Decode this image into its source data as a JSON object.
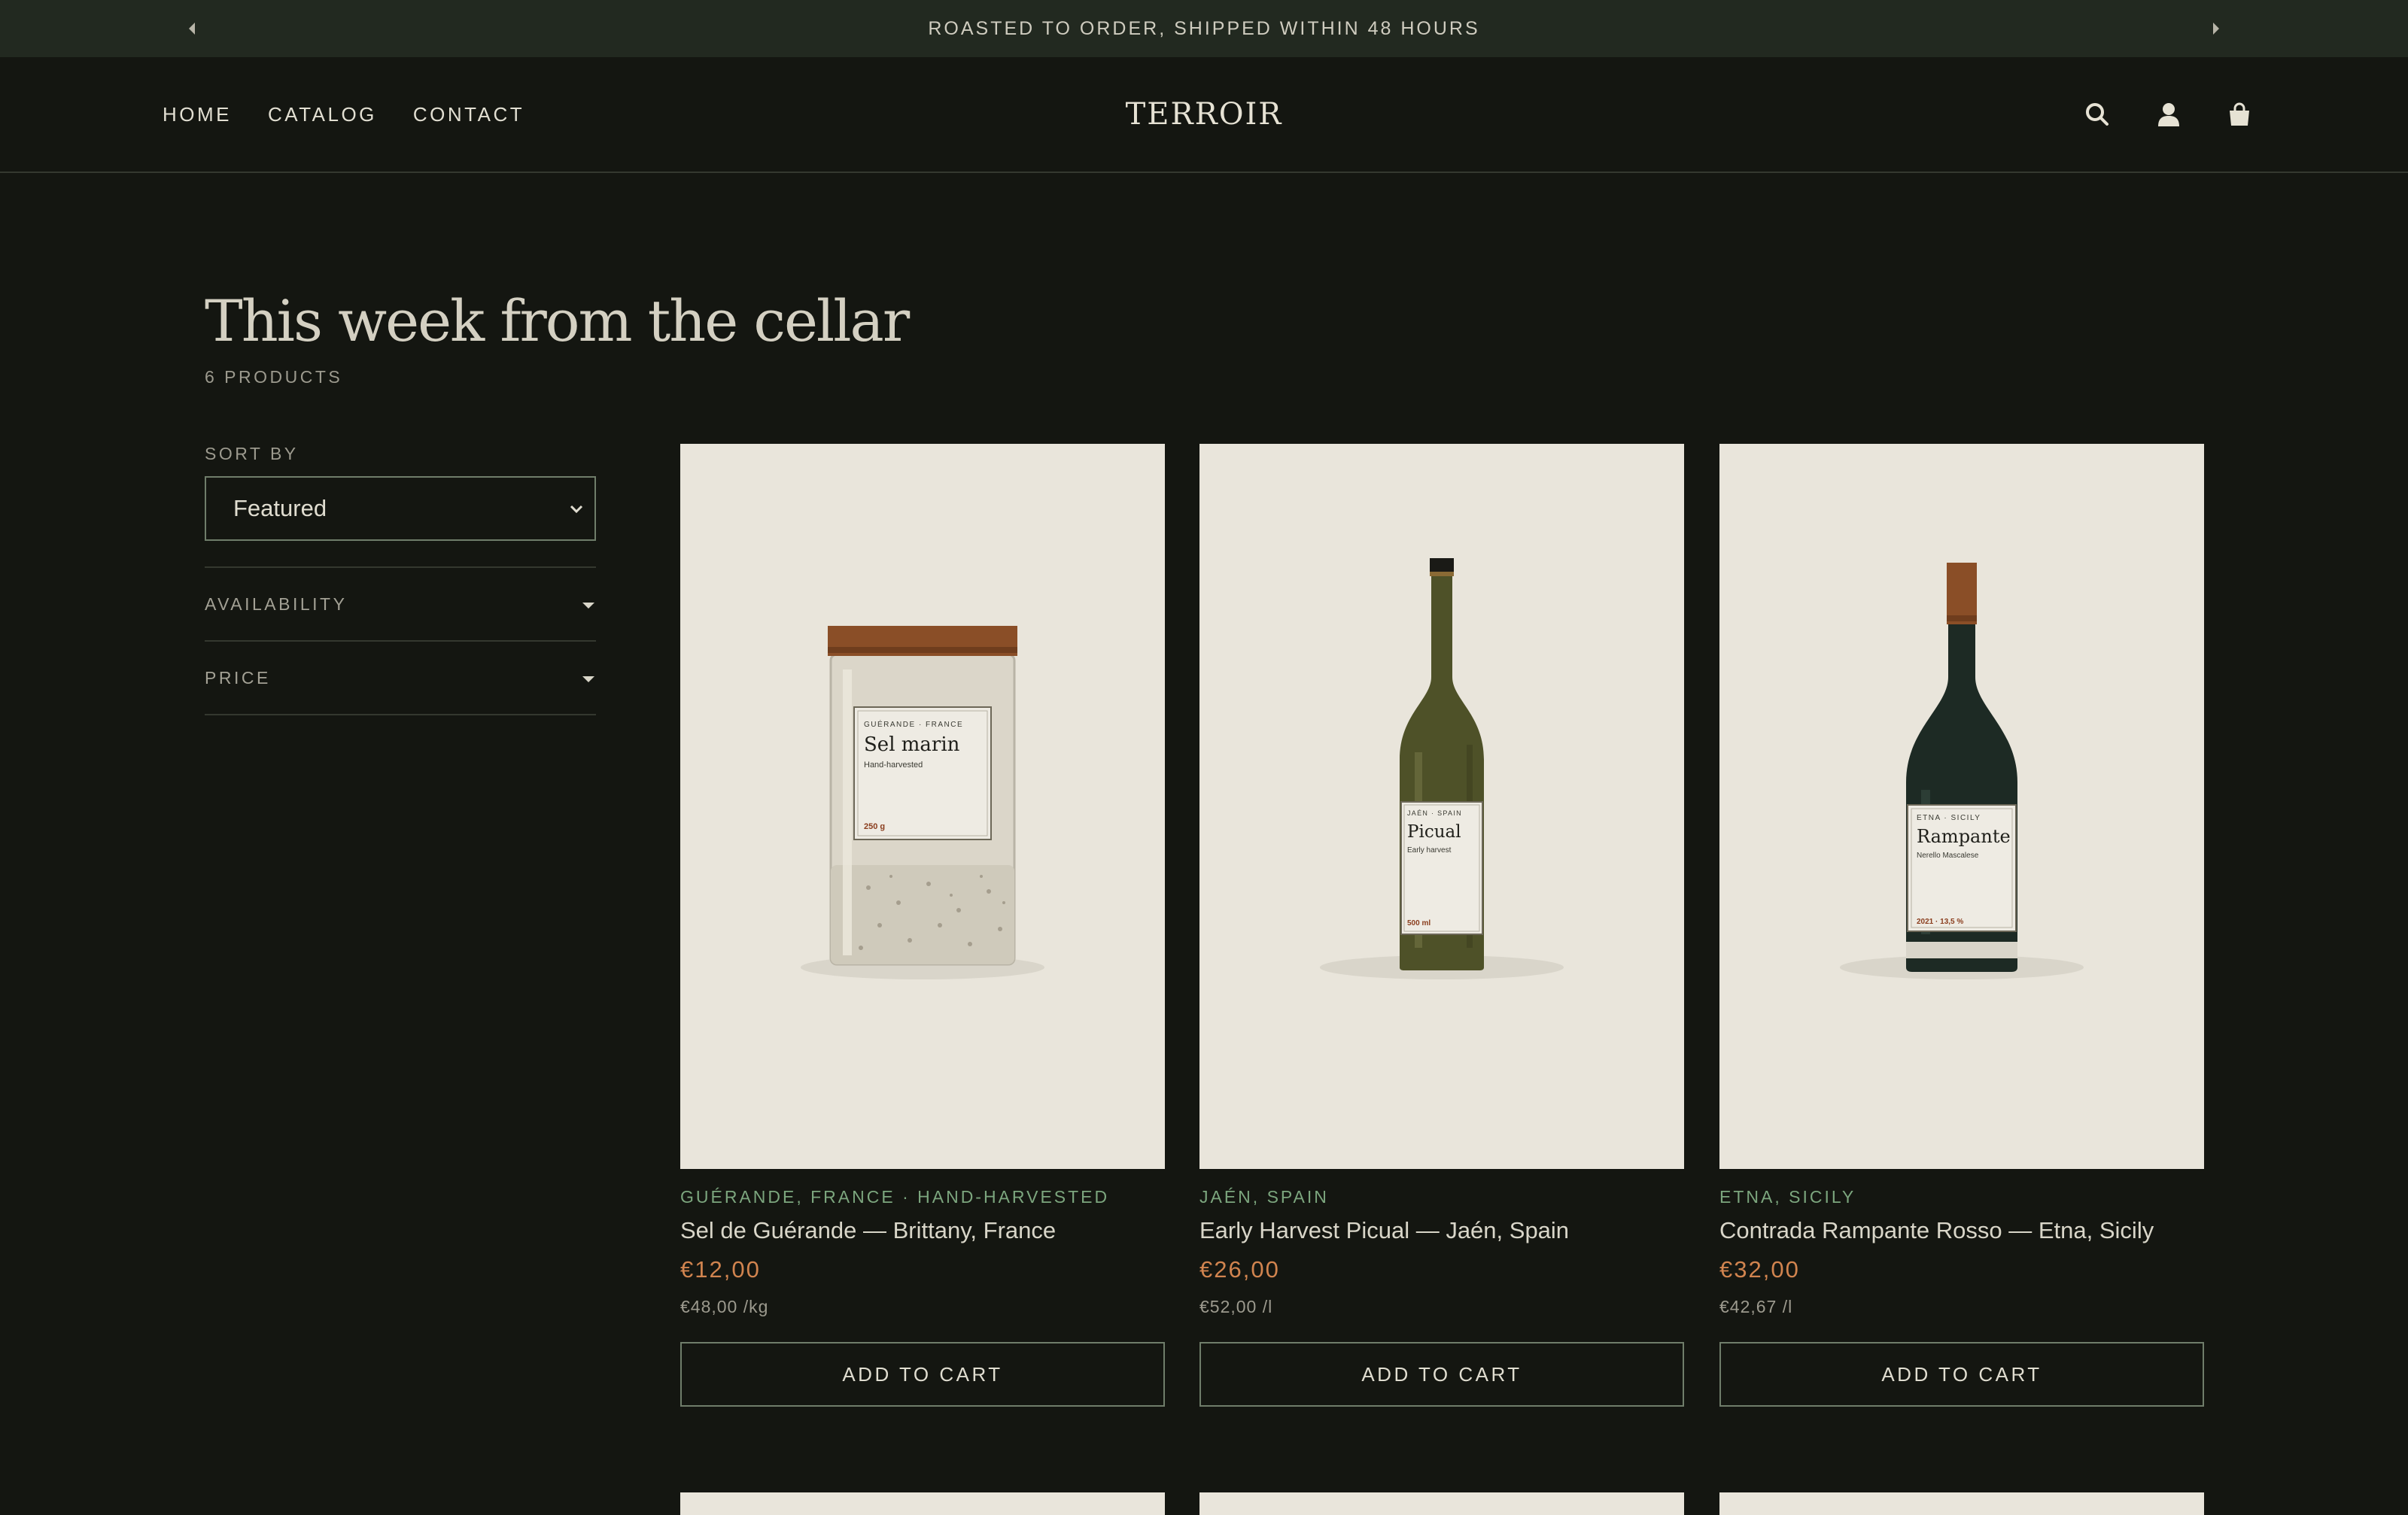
{
  "announcement": {
    "text": "ROASTED TO ORDER, SHIPPED WITHIN 48 HOURS"
  },
  "nav": {
    "items": [
      {
        "label": "HOME"
      },
      {
        "label": "CATALOG"
      },
      {
        "label": "CONTACT"
      }
    ]
  },
  "brand": {
    "logo": "TERROIR"
  },
  "header_icons": [
    "search-icon",
    "account-icon",
    "cart-icon"
  ],
  "collection": {
    "title": "This week from the cellar",
    "count": "6 PRODUCTS"
  },
  "sidebar": {
    "sort_label": "SORT BY",
    "sort_value": "Featured",
    "filters": [
      {
        "label": "AVAILABILITY"
      },
      {
        "label": "PRICE"
      }
    ]
  },
  "products": [
    {
      "origin": "GUÉRANDE, FRANCE · HAND-HARVESTED",
      "name": "Sel de Guérande — Brittany, France",
      "price": "€12,00",
      "unit_price": "€48,00 /kg",
      "button": "ADD TO CART",
      "label": {
        "region": "GUÉRANDE · FRANCE",
        "title": "Sel marin",
        "sub": "Hand-harvested",
        "foot": "250 g"
      }
    },
    {
      "origin": "JAÉN, SPAIN",
      "name": "Early Harvest Picual — Jaén, Spain",
      "price": "€26,00",
      "unit_price": "€52,00 /l",
      "button": "ADD TO CART",
      "label": {
        "region": "JAÉN · SPAIN",
        "title": "Picual",
        "sub": "Early harvest",
        "foot": "500 ml"
      }
    },
    {
      "origin": "ETNA, SICILY",
      "name": "Contrada Rampante Rosso — Etna, Sicily",
      "price": "€32,00",
      "unit_price": "€42,67 /l",
      "button": "ADD TO CART",
      "label": {
        "region": "ETNA · SICILY",
        "title": "Rampante",
        "sub": "Nerello Mascalese",
        "foot": "2021 · 13,5 %"
      }
    }
  ],
  "colors": {
    "background": "#141611",
    "announcement_bar": "#222920",
    "accent_green": "#7ca67e",
    "price_orange": "#d1844f",
    "card_background": "#e9e5db"
  }
}
